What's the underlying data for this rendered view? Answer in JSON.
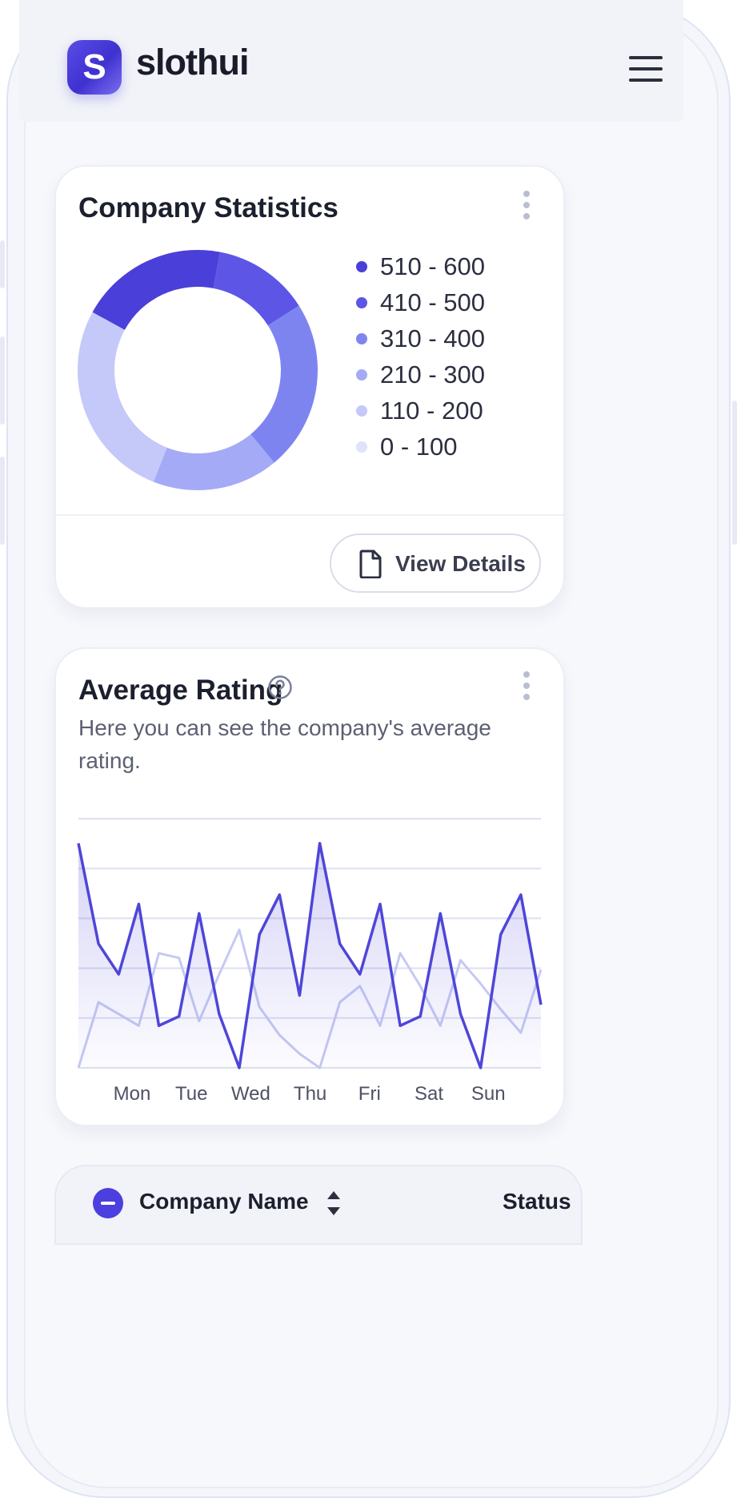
{
  "app": {
    "brand_letter": "S",
    "brand_name": "slothui"
  },
  "stats_card": {
    "title": "Company Statistics",
    "legend": [
      {
        "label": "510 - 600",
        "color": "#4a3fd8"
      },
      {
        "label": "410 - 500",
        "color": "#5d55e6"
      },
      {
        "label": "310 - 400",
        "color": "#7e84ef"
      },
      {
        "label": "210 - 300",
        "color": "#a4aaf6"
      },
      {
        "label": "110 - 200",
        "color": "#c4c9f9"
      },
      {
        "label": "0 - 100",
        "color": "#dfe2fb"
      }
    ],
    "view_details_label": "View Details"
  },
  "rating_card": {
    "title": "Average Rating",
    "description": "Here you can see the company's average rating."
  },
  "table": {
    "company_name_header": "Company Name",
    "status_header": "Status"
  },
  "chart_data": [
    {
      "type": "pie",
      "variant": "donut",
      "labels": [
        "510 - 600",
        "410 - 500",
        "310 - 400",
        "210 - 300",
        "110 - 200"
      ],
      "values": [
        20,
        13,
        23,
        17,
        27
      ],
      "colors": [
        "#4a3fd8",
        "#5d55e6",
        "#7e84ef",
        "#a4aaf6",
        "#c4c9f9"
      ],
      "legend_placement": "right"
    },
    {
      "type": "area",
      "categories": [
        "Mon",
        "Tue",
        "Wed",
        "Thu",
        "Fri",
        "Sat",
        "Sun"
      ],
      "grid": true,
      "ylim": [
        0,
        100
      ],
      "series": [
        {
          "values": [
            96,
            53,
            40,
            70,
            18,
            22,
            66,
            23,
            0,
            57,
            74,
            31,
            96,
            53,
            40,
            70,
            18,
            22,
            66,
            23,
            0,
            57,
            74,
            27
          ],
          "color": "#4e46d8"
        },
        {
          "values": [
            0,
            28,
            23,
            18,
            49,
            47,
            20,
            40,
            59,
            26,
            14,
            6,
            0,
            28,
            35,
            18,
            49,
            35,
            18,
            46,
            36,
            25,
            15,
            42
          ],
          "color": "#c5caf2"
        }
      ]
    }
  ]
}
